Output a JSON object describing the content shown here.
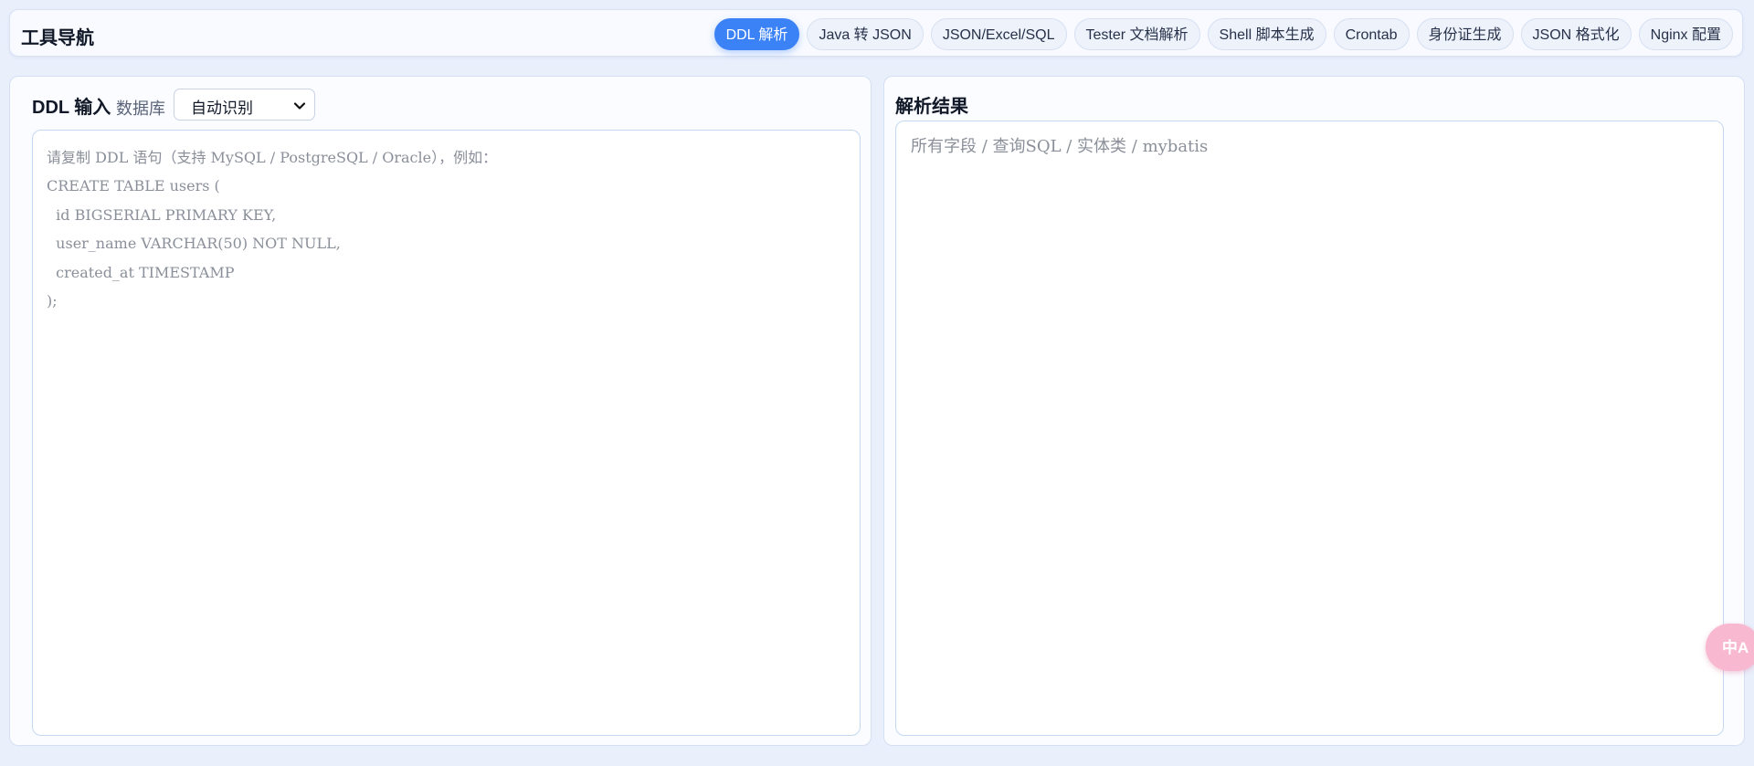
{
  "header": {
    "title": "工具导航",
    "tabs": [
      {
        "label": "DDL 解析",
        "active": true
      },
      {
        "label": "Java 转 JSON",
        "active": false
      },
      {
        "label": "JSON/Excel/SQL",
        "active": false
      },
      {
        "label": "Tester 文档解析",
        "active": false
      },
      {
        "label": "Shell 脚本生成",
        "active": false
      },
      {
        "label": "Crontab",
        "active": false
      },
      {
        "label": "身份证生成",
        "active": false
      },
      {
        "label": "JSON 格式化",
        "active": false
      },
      {
        "label": "Nginx 配置",
        "active": false
      }
    ]
  },
  "input_panel": {
    "title": "DDL 输入",
    "db_label": "数据库",
    "db_select_value": "自动识别",
    "placeholder_lines": [
      "请复制 DDL 语句（支持 MySQL / PostgreSQL / Oracle），例如：",
      "CREATE TABLE users (",
      "  id BIGSERIAL PRIMARY KEY,",
      "  user_name VARCHAR(50) NOT NULL,",
      "  created_at TIMESTAMP",
      ");"
    ]
  },
  "result_panel": {
    "title": "解析结果",
    "placeholder_lines": [
      "所有字段 / 查询SQL / 实体类 / mybatis"
    ]
  },
  "floating": {
    "translate_icon": "translate-icon",
    "translate_label": "中A"
  },
  "colors": {
    "accent": "#3b82f6",
    "background": "#e9effb",
    "translate_button": "#f8b8cf"
  }
}
